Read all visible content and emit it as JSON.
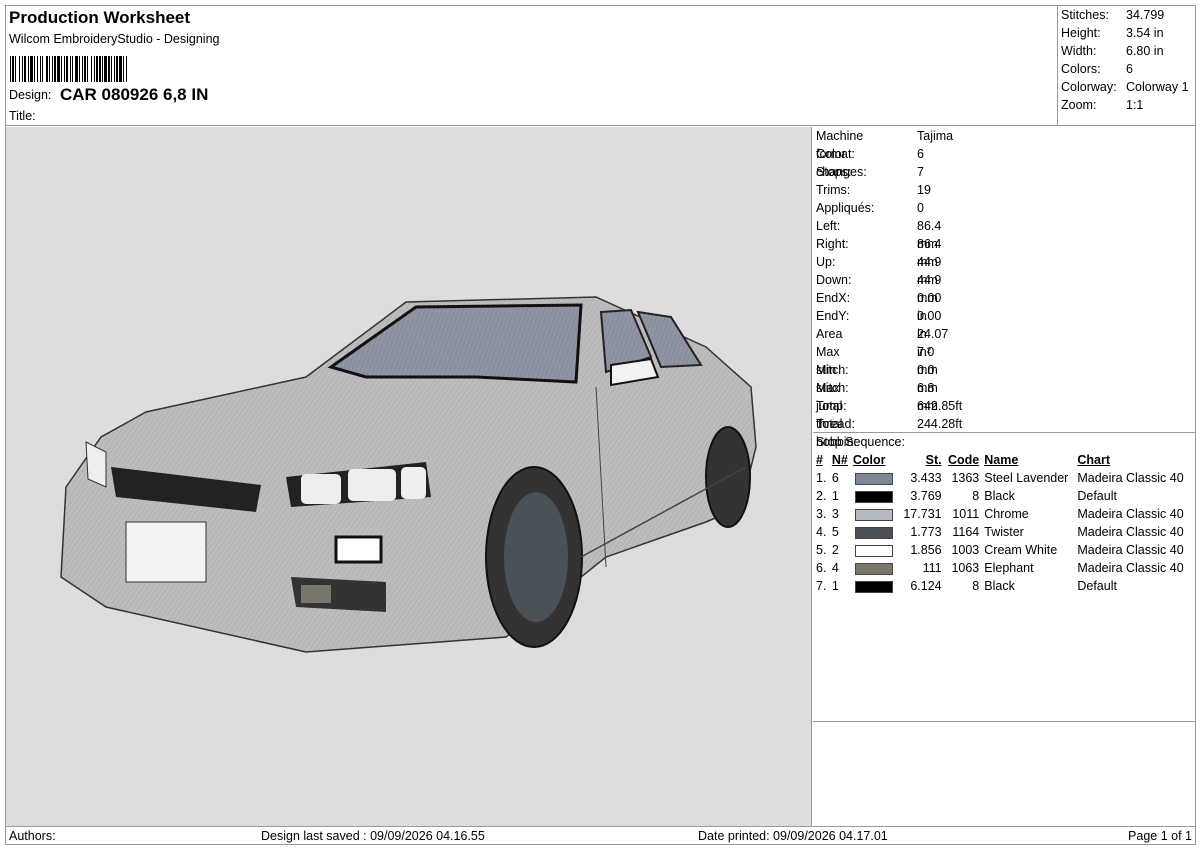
{
  "header": {
    "title": "Production Worksheet",
    "subtitle": "Wilcom EmbroideryStudio - Designing",
    "design_label": "Design:",
    "design_value": "CAR 080926 6,8 IN",
    "title_label": "Title:"
  },
  "stats": [
    {
      "label": "Stitches:",
      "value": "34.799"
    },
    {
      "label": "Height:",
      "value": "3.54 in"
    },
    {
      "label": "Width:",
      "value": "6.80 in"
    },
    {
      "label": "Colors:",
      "value": "6"
    },
    {
      "label": "Colorway:",
      "value": "Colorway 1"
    },
    {
      "label": "Zoom:",
      "value": "1:1"
    }
  ],
  "machine_info": [
    {
      "label": "Machine format:",
      "value": "Tajima"
    },
    {
      "label": "Color changes:",
      "value": "6"
    },
    {
      "label": "Stops:",
      "value": "7"
    },
    {
      "label": "Trims:",
      "value": "19"
    },
    {
      "label": "Appliqués:",
      "value": "0"
    },
    {
      "label": "Left:",
      "value": "86.4 mm"
    },
    {
      "label": "Right:",
      "value": "86.4 mm"
    },
    {
      "label": "Up:",
      "value": "44.9 mm"
    },
    {
      "label": "Down:",
      "value": "44.9 mm"
    },
    {
      "label": "EndX:",
      "value": "0.00 in"
    },
    {
      "label": "EndY:",
      "value": "0.00 in"
    },
    {
      "label": "Area",
      "value": " 24.07 in²"
    },
    {
      "label": "Max stitch:",
      "value": "7.0 mm"
    },
    {
      "label": "Min stitch:",
      "value": "0.0 mm"
    },
    {
      "label": "Max jump:",
      "value": "6.8 mm"
    },
    {
      "label": "Total thread:",
      "value": "642.85ft"
    },
    {
      "label": "Total bobbin:",
      "value": "244.28ft"
    }
  ],
  "stop_sequence": {
    "title": "Stop Sequence:",
    "headers": {
      "idx": "#",
      "n": "N#",
      "color": "Color",
      "st": "St.",
      "code": "Code",
      "name": "Name",
      "chart": "Chart"
    },
    "rows": [
      {
        "idx": "1.",
        "n": "6",
        "color": "#7d8796",
        "st": "3.433",
        "code": "1363",
        "name": "Steel Lavender",
        "chart": "Madeira Classic 40"
      },
      {
        "idx": "2.",
        "n": "1",
        "color": "#000000",
        "st": "3.769",
        "code": "8",
        "name": "Black",
        "chart": "Default"
      },
      {
        "idx": "3.",
        "n": "3",
        "color": "#b3bac2",
        "st": "17.731",
        "code": "1011",
        "name": "Chrome",
        "chart": "Madeira Classic 40"
      },
      {
        "idx": "4.",
        "n": "5",
        "color": "#4a5157",
        "st": "1.773",
        "code": "1164",
        "name": "Twister",
        "chart": "Madeira Classic 40"
      },
      {
        "idx": "5.",
        "n": "2",
        "color": "#ffffff",
        "st": "1.856",
        "code": "1003",
        "name": "Cream White",
        "chart": "Madeira Classic 40"
      },
      {
        "idx": "6.",
        "n": "4",
        "color": "#7a766c",
        "st": "111",
        "code": "1063",
        "name": "Elephant",
        "chart": "Madeira Classic 40"
      },
      {
        "idx": "7.",
        "n": "1",
        "color": "#000000",
        "st": "6.124",
        "code": "8",
        "name": "Black",
        "chart": "Default"
      }
    ]
  },
  "footer": {
    "authors": "Authors:",
    "last_saved": "Design last saved : 09/09/2026 04.16.55",
    "printed": "Date printed: 09/09/2026 04.17.01",
    "page": "Page 1 of 1"
  },
  "colors": {
    "design_background": "#dddddd",
    "car_body": "#b9b9b9",
    "windshield": "#8d93a0"
  }
}
